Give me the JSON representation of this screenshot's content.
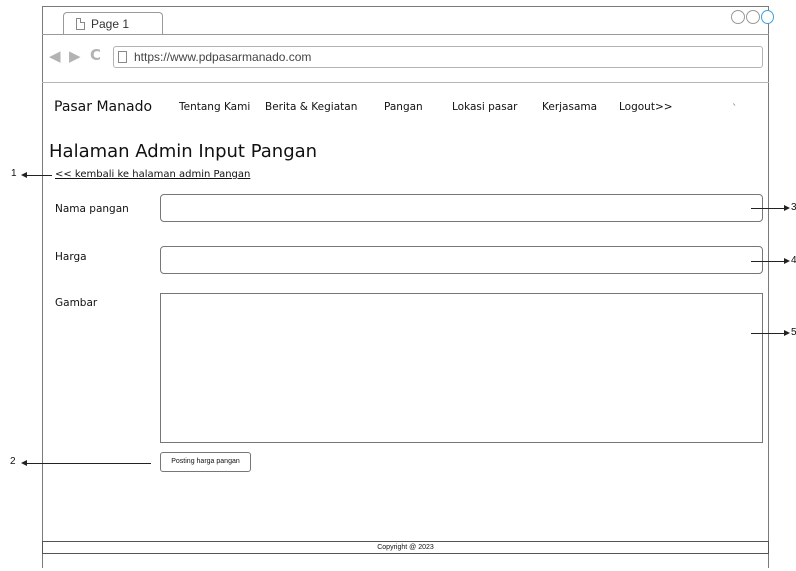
{
  "browser": {
    "tab_label": "Page 1",
    "url": "https://www.pdpasarmanado.com",
    "nav_icons": [
      "back-arrow-icon",
      "forward-arrow-icon",
      "reload-icon"
    ]
  },
  "site": {
    "brand": "Pasar Manado",
    "nav": [
      {
        "label": "Tentang Kami"
      },
      {
        "label": "Berita & Kegiatan"
      },
      {
        "label": "Pangan"
      },
      {
        "label": "Lokasi pasar"
      },
      {
        "label": "Kerjasama"
      },
      {
        "label": "Logout>>"
      }
    ],
    "stray_mark": "`"
  },
  "page": {
    "title": "Halaman Admin Input Pangan",
    "back_link": "<< kembali ke halaman admin Pangan"
  },
  "form": {
    "name_label": "Nama pangan",
    "price_label": "Harga",
    "image_label": "Gambar",
    "submit_label": "Posting harga pangan"
  },
  "footer": {
    "copyright": "Copyright @ 2023"
  },
  "annotations": {
    "a1": "1",
    "a2": "2",
    "a3": "3",
    "a4": "4",
    "a5": "5"
  },
  "colors": {
    "window_button_accent": "#3ea0e0"
  }
}
